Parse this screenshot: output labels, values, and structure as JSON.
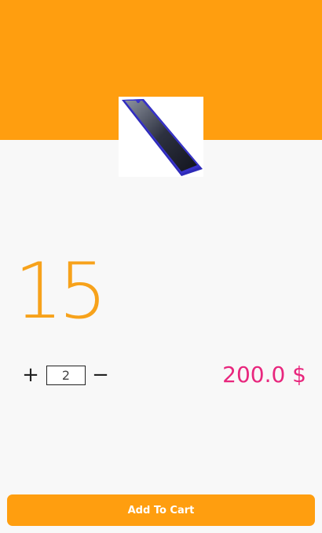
{
  "product": {
    "image_icon": "smartphone-image",
    "name": "15",
    "quantity": "2",
    "price": "200.0 $"
  },
  "controls": {
    "increment_symbol": "+",
    "decrement_symbol": "−",
    "add_to_cart_label": "Add To Cart"
  },
  "colors": {
    "accent": "#ff9e0f",
    "title": "#f7a21b",
    "price": "#e8267d",
    "background": "#f8f8f8"
  }
}
